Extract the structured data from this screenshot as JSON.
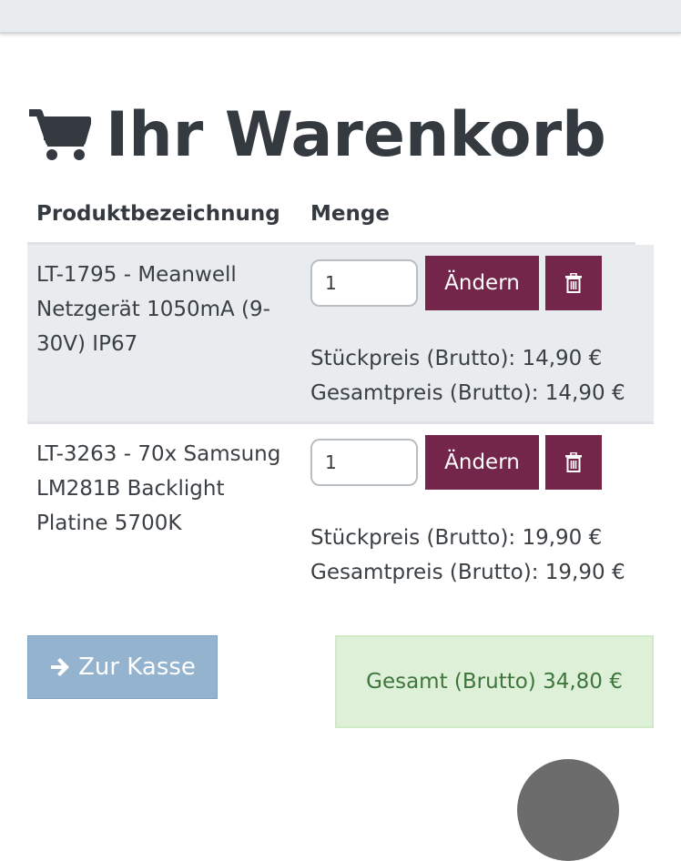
{
  "page": {
    "title": "Ihr Warenkorb",
    "icons": {
      "title": "shopping-cart-icon",
      "delete": "trash-icon",
      "checkout": "arrow-right-icon"
    }
  },
  "table": {
    "headers": {
      "product": "Produktbezeichnung",
      "quantity": "Menge"
    },
    "items": [
      {
        "name": "LT-1795 - Meanwell Netzgerät 1050mA (9-30V) IP67",
        "quantity": "1",
        "change_label": "Ändern",
        "unit_price": "Stückpreis (Brutto): 14,90 €",
        "total_price": "Gesamtpreis (Brutto): 14,90 €"
      },
      {
        "name": "LT-3263 - 70x Samsung LM281B Backlight Platine 5700K",
        "quantity": "1",
        "change_label": "Ändern",
        "unit_price": "Stückpreis (Brutto): 19,90 €",
        "total_price": "Gesamtpreis (Brutto): 19,90 €"
      }
    ]
  },
  "checkout": {
    "label": "Zur Kasse"
  },
  "summary": {
    "total": "Gesamt (Brutto) 34,80 €"
  },
  "colors": {
    "primary": "#74254a",
    "checkout": "#93b3cf",
    "success_bg": "#dff0d8",
    "success_text": "#3c763d"
  }
}
